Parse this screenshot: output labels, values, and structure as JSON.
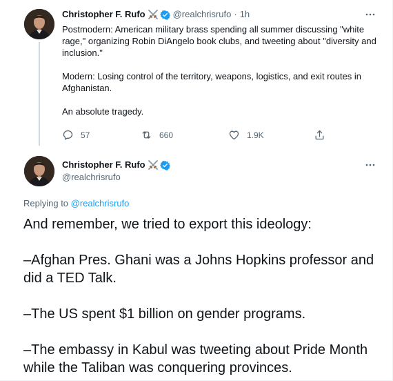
{
  "colors": {
    "text": "#0f1419",
    "secondary": "#536471",
    "link": "#1d9bf0",
    "verified": "#1d9bf0",
    "thread_line": "#cfd9de"
  },
  "tweet1": {
    "author_name": "Christopher F. Rufo",
    "handle": "@realchrisrufo",
    "separator": "·",
    "time": "1h",
    "paragraphs": [
      "Postmodern: American military brass spending all summer discussing \"white rage,\" organizing Robin DiAngelo book clubs, and tweeting about \"diversity and inclusion.\"",
      "Modern: Losing control of the territory, weapons, logistics, and exit routes in Afghanistan.",
      "An absolute tragedy."
    ],
    "actions": {
      "reply_count": "57",
      "retweet_count": "660",
      "like_count": "1.9K"
    },
    "icons": {
      "verified": "verified-badge-icon",
      "emoji": "crossed-swords-icon",
      "more": "more-options-icon",
      "reply": "reply-icon",
      "retweet": "retweet-icon",
      "like": "heart-icon",
      "share": "share-icon"
    }
  },
  "tweet2": {
    "author_name": "Christopher F. Rufo",
    "handle": "@realchrisrufo",
    "replying_prefix": "Replying to",
    "replying_handle": "@realchrisrufo",
    "paragraphs": [
      "And remember, we tried to export this ideology:",
      "–Afghan Pres. Ghani was a Johns Hopkins professor and did a TED Talk.",
      "–The US spent $1 billion on gender programs.",
      "–The embassy in Kabul was tweeting about Pride Month while the Taliban was conquering provinces."
    ]
  }
}
